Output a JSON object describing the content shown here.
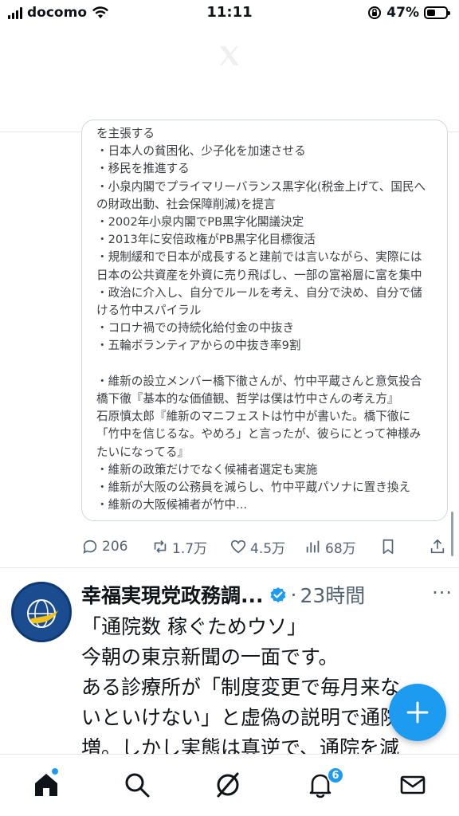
{
  "status_bar": {
    "carrier": "docomo",
    "time": "11:11",
    "battery_percent": "47%",
    "battery_level": 0.47
  },
  "quoted_post": {
    "text": "を主張する\n・日本人の貧困化、少子化を加速させる\n・移民を推進する\n・小泉内閣でプライマリーバランス黒字化(税金上げて、国民へ\nの財政出動、社会保障削減)を提言\n・2002年小泉内閣でPB黒字化閣議決定\n・2013年に安倍政権がPB黒字化目標復活\n・規制緩和で日本が成長すると建前では言いながら、実際には\n日本の公共資産を外資に売り飛ばし、一部の富裕層に富を集中\n・政治に介入し、自分でルールを考え、自分で決め、自分で儲\nける竹中スパイラル\n・コロナ禍での持続化給付金の中抜き\n・五輪ボランティアからの中抜き率9割\n\n・維新の設立メンバー橋下徹さんが、竹中平蔵さんと意気投合\n橋下徹『基本的な価値観、哲学は僕は竹中さんの考え方』\n石原慎太郎『維新のマニフェストは竹中が書いた。橋下徹に\n「竹中を信じるな。やめろ」と言ったが、彼らにとって神様み\nたいになってる』\n・維新の政策だけでなく候補者選定も実施\n・維新が大阪の公務員を減らし、竹中平蔵パソナに置き換え\n・維新の大阪候補者が竹中..."
  },
  "actions": {
    "replies": "206",
    "reposts": "1.7万",
    "likes": "4.5万",
    "views": "68万"
  },
  "post": {
    "author": "幸福実現党政務調...",
    "separator": "·",
    "time": "23時間",
    "more": "···",
    "avatar_text": "HAPPINESS REALIZATION PARTY",
    "body": "「通院数 稼ぐためウソ」\n今朝の東京新聞の一面です。\nある診療所が「制度変更で毎月来な\nいといけない」と虚偽の説明で通院\n増。しかし実態は真逆で、通院を減"
  },
  "nav": {
    "notification_count": "6"
  },
  "colors": {
    "accent": "#1d9bf0",
    "text": "#0f1419",
    "secondary": "#536471"
  }
}
